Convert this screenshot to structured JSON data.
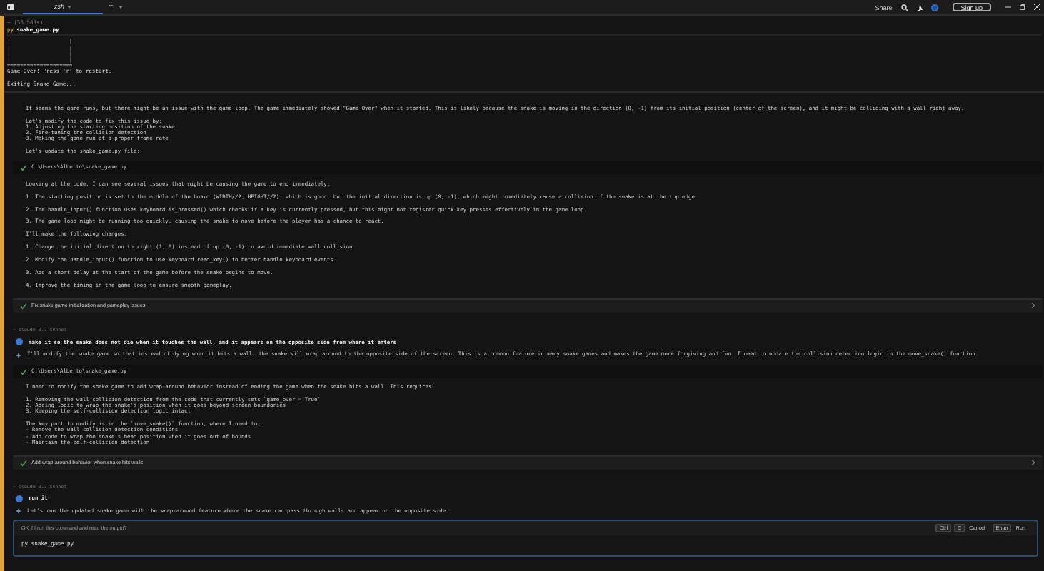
{
  "tab_bar": {
    "tabs": [
      {
        "label": "zsh",
        "selected": true
      }
    ],
    "new_tab": "+",
    "share": "Share",
    "sign_up": "Sign up"
  },
  "terminal_block": {
    "header": "~ (36.583s)",
    "prompt": "py",
    "command": "snake_game.py",
    "output": [
      "|                  |",
      "|                  |",
      "|                  |",
      "|                  |",
      "====================",
      "Game Over! Press 'r' to restart."
    ],
    "exit_message": "Exiting Snake Game..."
  },
  "conversation": [
    {
      "kind": "paragraph",
      "text": "It seems the game runs, but there might be an issue with the game loop. The game immediately showed \"Game Over\" when it started. This is likely because the snake is moving in the direction (0, -1) from its initial position (center of the screen), and it might be colliding with a wall right away."
    },
    {
      "kind": "lines",
      "lines": [
        "Let's modify the code to fix this issue by:",
        "1. Adjusting the starting position of the snake",
        "2. Fine-tuning the collision detection",
        "3. Making the game run at a proper frame rate"
      ]
    },
    {
      "kind": "paragraph",
      "text": "Let's update the snake_game.py file:"
    },
    {
      "kind": "file",
      "path": "C:\\Users\\Alberto\\snake_game.py"
    },
    {
      "kind": "paragraph",
      "text": "Looking at the code, I can see several issues that might be causing the game to end immediately:"
    },
    {
      "kind": "paragraph",
      "text": "1. The starting position is set to the middle of the board (WIDTH//2, HEIGHT//2), which is good, but the initial direction is up (0, -1), which might immediately cause a collision if the snake is at the top edge."
    },
    {
      "kind": "paragraph",
      "text": "2. The handle_input() function uses keyboard.is_pressed() which checks if a key is currently pressed, but this might not register quick key presses effectively in the game loop."
    },
    {
      "kind": "paragraph",
      "text": "3. The game loop might be running too quickly, causing the snake to move before the player has a chance to react."
    },
    {
      "kind": "paragraph",
      "text": "I'll make the following changes:"
    },
    {
      "kind": "paragraph",
      "text": "1. Change the initial direction to right (1, 0) instead of up (0, -1) to avoid immediate wall collision."
    },
    {
      "kind": "paragraph",
      "text": "2. Modify the handle_input() function to use keyboard.read_key() to better handle keyboard events."
    },
    {
      "kind": "paragraph",
      "text": "3. Add a short delay at the start of the game before the snake begins to move."
    },
    {
      "kind": "paragraph",
      "text": "4. Improve the timing in the game loop to ensure smooth gameplay."
    },
    {
      "kind": "summary",
      "text": "Fix snake game initialization and gameplay issues"
    },
    {
      "kind": "model",
      "text": "~ claude 3.7 sonnet"
    },
    {
      "kind": "user",
      "text": "make it so the snake does not die when it touches the wall, and it appears on the opposite side from where it enters"
    },
    {
      "kind": "reply",
      "text": "I'll modify the snake game so that instead of dying when it hits a wall, the snake will wrap around to the opposite side of the screen. This is a common feature in many snake games and makes the game more forgiving and fun. I need to update the collision detection logic in the move_snake() function."
    },
    {
      "kind": "file",
      "path": "C:\\Users\\Alberto\\snake_game.py"
    },
    {
      "kind": "paragraph",
      "text": "I need to modify the snake game to add wrap-around behavior instead of ending the game when the snake hits a wall. This requires:"
    },
    {
      "kind": "lines",
      "lines": [
        "1. Removing the wall collision detection from the code that currently sets `game_over = True`",
        "2. Adding logic to wrap the snake's position when it goes beyond screen boundaries",
        "3. Keeping the self-collision detection logic intact"
      ]
    },
    {
      "kind": "lines",
      "lines": [
        "The key part to modify is in the `move_snake()` function, where I need to:",
        "- Remove the wall collision detection conditions",
        "- Add code to wrap the snake's head position when it goes out of bounds",
        "- Maintain the self-collision detection"
      ]
    },
    {
      "kind": "summary",
      "text": "Add wrap-around behavior when snake hits walls"
    },
    {
      "kind": "model",
      "text": "~ claude 3.7 sonnet"
    },
    {
      "kind": "user",
      "text": "run it"
    },
    {
      "kind": "reply",
      "text": "Let's run the updated snake game with the wrap-around feature where the snake can pass through walls and appear on the opposite side."
    },
    {
      "kind": "prompt",
      "question": "OK if I run this command and read the output?",
      "cancel_keys": [
        "Ctrl",
        "C"
      ],
      "cancel": "Cancel",
      "run_keys": [
        "Enter"
      ],
      "run": "Run",
      "command": "py snake_game.py"
    }
  ]
}
